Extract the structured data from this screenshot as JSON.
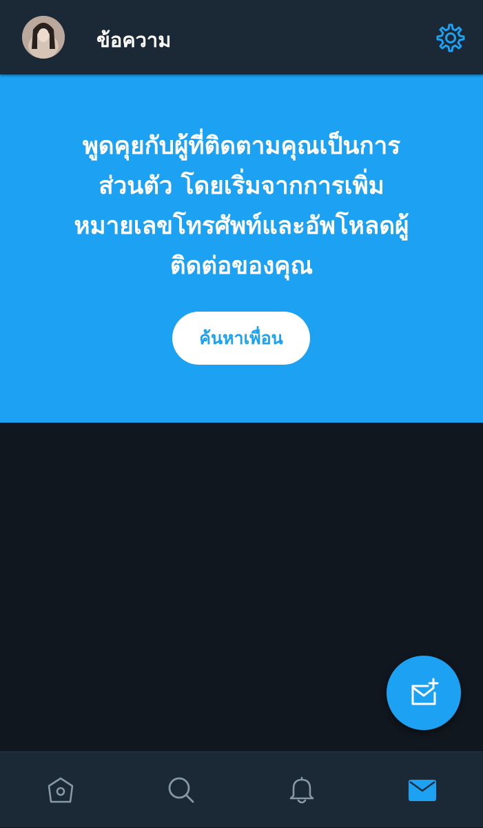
{
  "header": {
    "title": "ข้อความ",
    "avatar_icon": "profile-avatar",
    "settings_icon": "gear-icon"
  },
  "banner": {
    "lines": [
      "พูดคุยกับผู้ที่ติดตามคุณเป็นการ",
      "ส่วนตัว โดยเริ่มจากการเพิ่ม",
      "หมายเลขโทรศัพท์และอัพโหลดผู้",
      "ติดต่อของคุณ"
    ],
    "button_label": "ค้นหาเพื่อน"
  },
  "fab": {
    "icon": "new-message-icon"
  },
  "bottom_nav": {
    "items": [
      {
        "icon": "home-icon",
        "active": false
      },
      {
        "icon": "search-icon",
        "active": false
      },
      {
        "icon": "bell-icon",
        "active": false
      },
      {
        "icon": "mail-icon",
        "active": true
      }
    ]
  },
  "colors": {
    "accent": "#1da1f2",
    "header_bg": "#1b2836",
    "page_bg": "#10171e",
    "inactive_icon": "#8899a6"
  }
}
